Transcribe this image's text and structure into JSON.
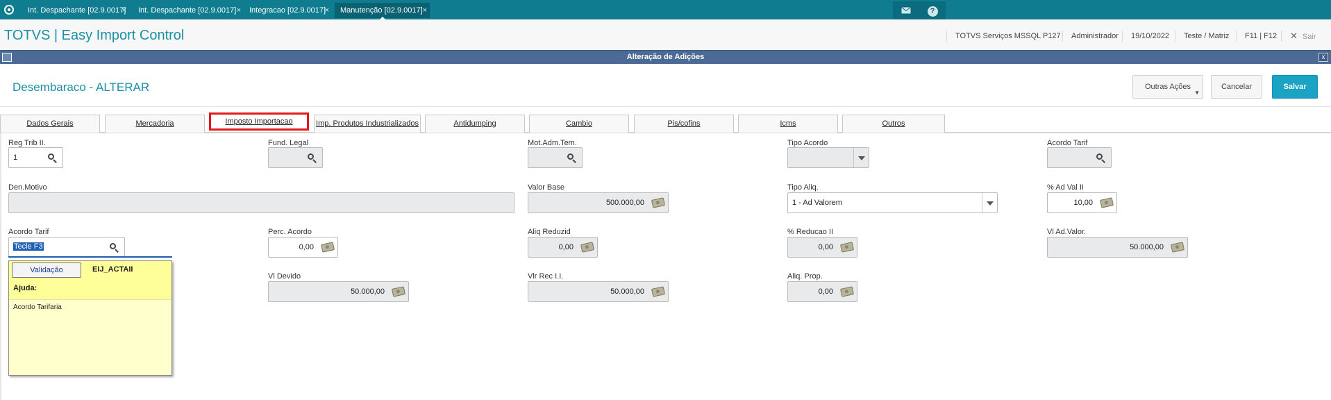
{
  "top_tabs": [
    {
      "label": "Int. Despachante [02.9.0017]",
      "close": "×"
    },
    {
      "label": "Int. Despachante [02.9.0017]",
      "close": "×"
    },
    {
      "label": "Integracao [02.9.0017]",
      "close": "×"
    },
    {
      "label": "Manutenção [02.9.0017]",
      "close": "×"
    }
  ],
  "top_icons": {
    "mail": "mail-icon",
    "help": "help-icon",
    "help_glyph": "?"
  },
  "header": {
    "app_title": "TOTVS | Easy Import Control",
    "server": "TOTVS Serviços MSSQL P127",
    "user": "Administrador",
    "date": "19/10/2022",
    "branch": "Teste / Matriz",
    "keys": "F11 | F12",
    "exit_label": "Sair",
    "exit_glyph": "✕"
  },
  "window": {
    "title": "Alteração de Adições",
    "close_glyph": "x"
  },
  "form": {
    "title": "Desembaraco - ALTERAR",
    "more_actions": "Outras Ações",
    "more_caret": "▼",
    "cancel": "Cancelar",
    "save": "Salvar"
  },
  "folder_tabs": [
    {
      "label": "Dados Gerais"
    },
    {
      "label": "Mercadoria"
    },
    {
      "label": "Imposto Importacao",
      "active": true
    },
    {
      "label": "Imp. Produtos Industrializados"
    },
    {
      "label": "Antidumping"
    },
    {
      "label": "Cambio"
    },
    {
      "label": "Pis/cofins"
    },
    {
      "label": "Icms"
    },
    {
      "label": "Outros"
    }
  ],
  "fields": {
    "reg_trib_ii": {
      "label": "Reg Trib II.",
      "value": "1"
    },
    "fund_legal": {
      "label": "Fund. Legal",
      "value": ""
    },
    "mot_adm_tem": {
      "label": "Mot.Adm.Tem.",
      "value": ""
    },
    "tipo_acordo": {
      "label": "Tipo Acordo",
      "value": ""
    },
    "acordo_tarif_1": {
      "label": "Acordo Tarif",
      "value": ""
    },
    "den_motivo": {
      "label": "Den.Motivo",
      "value": ""
    },
    "valor_base": {
      "label": "Valor Base",
      "value": "500.000,00"
    },
    "tipo_aliq": {
      "label": "Tipo Aliq.",
      "value": "1 - Ad Valorem"
    },
    "ad_val_ii": {
      "label": "% Ad Val II",
      "value": "10,00"
    },
    "acordo_tarif_2": {
      "label": "Acordo Tarif",
      "value": "Tecle F3"
    },
    "perc_acordo": {
      "label": "Perc. Acordo",
      "value": "0,00"
    },
    "aliq_reduzid": {
      "label": "Aliq Reduzid",
      "value": "0,00"
    },
    "perc_reducao_ii": {
      "label": "% Reducao II",
      "value": "0,00"
    },
    "vl_ad_valor": {
      "label": "Vl Ad.Valor.",
      "value": "50.000,00"
    },
    "vl_devido": {
      "label": "Vl Devido",
      "value": "50.000,00"
    },
    "vlr_rec_ii": {
      "label": "Vlr Rec I.I.",
      "value": "50.000,00"
    },
    "aliq_prop": {
      "label": "Aliq. Prop.",
      "value": "0,00"
    }
  },
  "popup": {
    "validation_button": "Validação",
    "code": "EIJ_ACTAII",
    "help_heading": "Ajuda:",
    "help_text": "Acordo Tarifaria"
  },
  "colors": {
    "topbar": "#0f7c8f",
    "accent": "#1a8fa6",
    "window_bar": "#4b6a94",
    "save_button": "#1aa3c2",
    "active_tab_border": "#e01a1a",
    "popup_bg": "#ffffcc"
  }
}
